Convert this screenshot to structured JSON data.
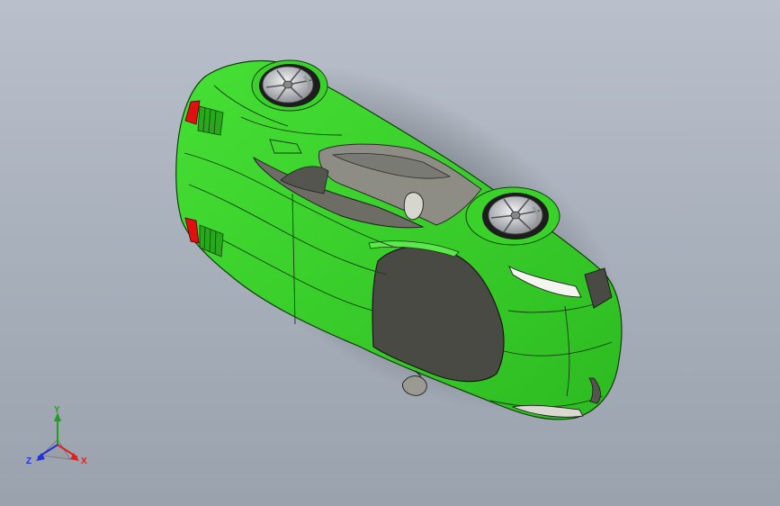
{
  "viewport": {
    "background_top": "#b9c0cb",
    "background_bottom": "#9aa2ad"
  },
  "model": {
    "body_color": "#3ad12a",
    "body_dark": "#2aa81d",
    "glass_color": "#4a4a44",
    "roof_color": "#8d8d86",
    "tail_light_color": "#e01010",
    "wheel_color": "#c9ccd1",
    "icons": [
      "car-body-icon",
      "wheel-icon",
      "wheel-icon",
      "side-mirror-icon"
    ]
  },
  "triad": {
    "x_label": "X",
    "y_label": "Y",
    "z_label": "Z",
    "x_color": "#e02020",
    "y_color": "#20a020",
    "z_color": "#2030e0"
  }
}
